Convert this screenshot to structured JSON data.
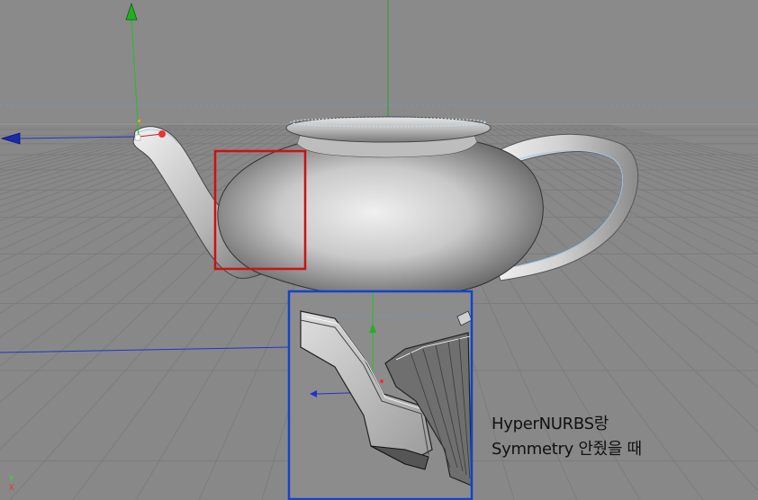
{
  "caption": {
    "line1": "HyperNURBS랑",
    "line2": "Symmetry 안줬을 때"
  },
  "axis_indicator": {
    "y_label": "Y",
    "x_label": "X"
  },
  "colors": {
    "viewport_bg": "#888888",
    "grid_line": "#7a7a7a",
    "horizon_dash": "#6b8fb5",
    "axis_y": "#22c022",
    "axis_x_blue": "#2233cc",
    "highlight_red": "#cc1111",
    "inset_border_blue": "#1144cc"
  },
  "icons": {
    "y_axis_handle": "green-cone-arrow-icon",
    "x_axis_handle": "blue-cone-arrow-icon",
    "point_handle": "red-dot-icon"
  }
}
